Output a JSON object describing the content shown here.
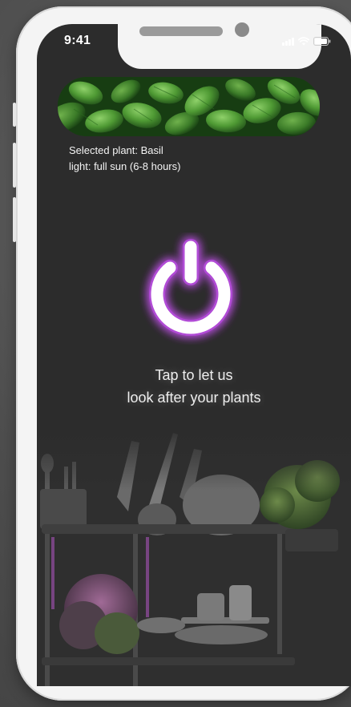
{
  "status_bar": {
    "time": "9:41",
    "signal_icon": "cellular-signal-icon",
    "wifi_icon": "wifi-icon",
    "battery_icon": "battery-icon"
  },
  "hero": {
    "image": "basil-leaves-photo"
  },
  "plant": {
    "selected_line": "Selected plant: Basil",
    "light_line": "light: full sun (6-8 hours)"
  },
  "power": {
    "icon": "power-icon",
    "glow_color": "#b14bd6"
  },
  "cta": {
    "line1": "Tap to let us",
    "line2": "look after your plants"
  },
  "colors": {
    "screen_bg": "#2c2c2c",
    "accent_purple": "#b14bd6",
    "frame": "#f4f4f4"
  }
}
